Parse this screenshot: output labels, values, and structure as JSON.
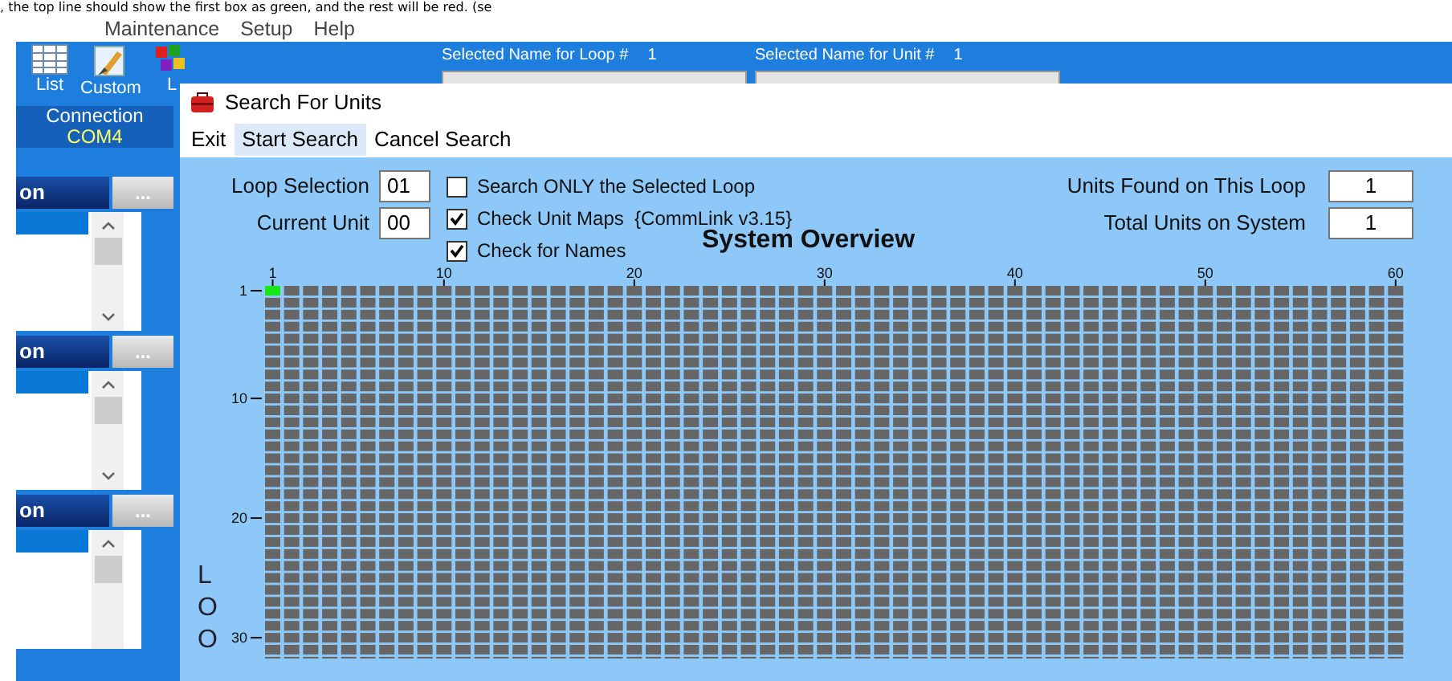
{
  "document_text": ", the top line should show the first box as green, and the rest will be red. (se",
  "menu": [
    "Maintenance",
    "Setup",
    "Help"
  ],
  "toolbar": [
    {
      "label": "List",
      "kind": "table"
    },
    {
      "label": "Custom",
      "kind": "brush"
    },
    {
      "label": "L",
      "kind": "blocks"
    }
  ],
  "selected_loop": {
    "label": "Selected Name for Loop #",
    "value": "1"
  },
  "selected_unit": {
    "label": "Selected Name for Unit #",
    "value": "1"
  },
  "connection": {
    "label": "Connection",
    "port": "COM4"
  },
  "sections": [
    {
      "label": "on",
      "button": "..."
    },
    {
      "label": "on",
      "button": "..."
    },
    {
      "label": "on",
      "button": "..."
    }
  ],
  "dialog": {
    "title": "Search For Units",
    "menu": [
      {
        "label": "Exit",
        "selected": false
      },
      {
        "label": "Start Search",
        "selected": true
      },
      {
        "label": "Cancel Search",
        "selected": false
      }
    ],
    "loop_selection": {
      "label": "Loop Selection",
      "value": "01"
    },
    "current_unit": {
      "label": "Current Unit",
      "value": "00"
    },
    "options": [
      {
        "label": "Search ONLY the Selected Loop",
        "checked": false
      },
      {
        "label": "Check Unit Maps  {CommLink v3.15}",
        "checked": true
      },
      {
        "label": "Check for Names",
        "checked": true
      }
    ],
    "units_found": {
      "label": "Units Found on This Loop",
      "value": "1"
    },
    "total_units": {
      "label": "Total Units on System",
      "value": "1"
    },
    "overview": {
      "title": "System Overview",
      "axis_title": "LOO",
      "column_labels": [
        "1",
        "10",
        "20",
        "30",
        "40",
        "50",
        "60"
      ],
      "row_labels": [
        "1",
        "10",
        "20",
        "30"
      ],
      "found_units": [
        {
          "color": "#19e619"
        }
      ]
    }
  }
}
